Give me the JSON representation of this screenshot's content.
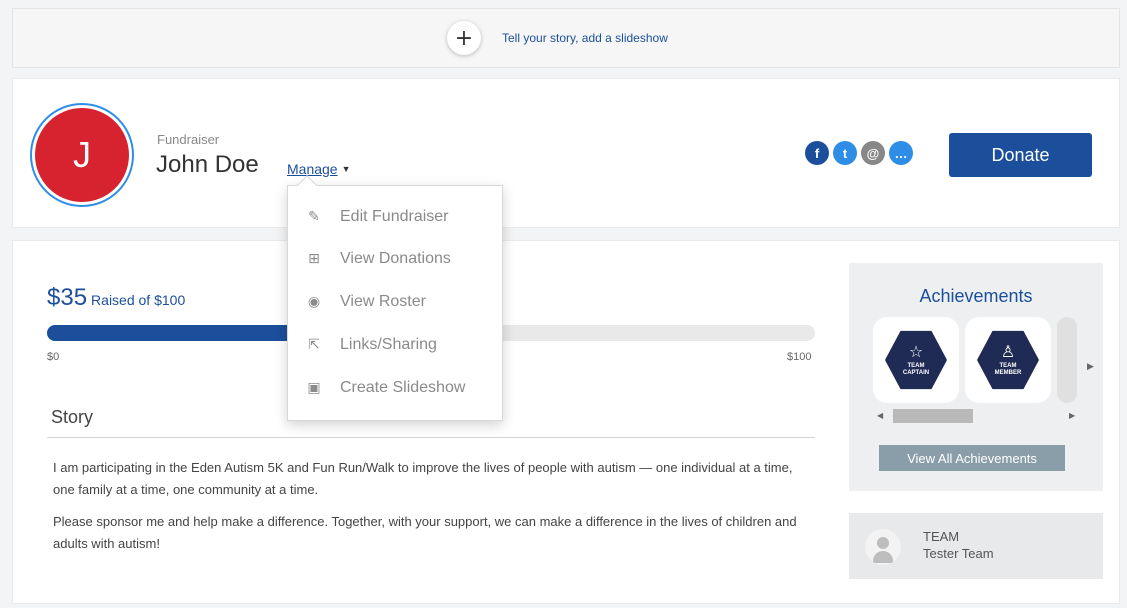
{
  "top_bar": {
    "add_icon": "+",
    "add_text": "Tell your story, add a slideshow"
  },
  "header": {
    "avatar_initial": "J",
    "role": "Fundraiser",
    "name": "John Doe",
    "manage_label": "Manage",
    "social": [
      {
        "icon": "facebook-icon",
        "glyph": "f",
        "color": "#1b4f9b"
      },
      {
        "icon": "twitter-icon",
        "glyph": "t",
        "color": "#2e8ee6"
      },
      {
        "icon": "email-icon",
        "glyph": "@",
        "color": "#888888"
      },
      {
        "icon": "chat-icon",
        "glyph": "…",
        "color": "#2e8ee6"
      }
    ],
    "donate_label": "Donate"
  },
  "manage_menu": {
    "items": [
      {
        "label": "Edit Fundraiser",
        "icon": "edit-icon",
        "glyph": "✎"
      },
      {
        "label": "View Donations",
        "icon": "gift-icon",
        "glyph": "⊞"
      },
      {
        "label": "View Roster",
        "icon": "eye-icon",
        "glyph": "◉"
      },
      {
        "label": "Links/Sharing",
        "icon": "share-icon",
        "glyph": "⇱"
      },
      {
        "label": "Create Slideshow",
        "icon": "image-icon",
        "glyph": "▣"
      }
    ]
  },
  "progress": {
    "amount": "$35",
    "raised_label": "Raised of $100",
    "min_label": "$0",
    "max_label": "$100",
    "fraction": 0.35
  },
  "story": {
    "title": "Story",
    "paragraphs": [
      "I am participating in the Eden Autism 5K and Fun Run/Walk to improve the lives of people with autism — one individual at a time, one family at a time, one community at a time.",
      "Please sponsor me and help make a difference. Together, with your support, we can make a difference in the lives of children and adults with autism!"
    ]
  },
  "achievements": {
    "title": "Achievements",
    "badges": [
      {
        "label_line1": "TEAM",
        "label_line2": "CAPTAIN",
        "glyph": "☆"
      },
      {
        "label_line1": "TEAM",
        "label_line2": "MEMBER",
        "glyph": "♙"
      }
    ],
    "view_all_label": "View All Achievements"
  },
  "team": {
    "label": "TEAM",
    "name": "Tester Team"
  },
  "colors": {
    "brand_blue": "#1b4f9b",
    "light_blue": "#2e8ee6",
    "avatar_red": "#d7232f"
  }
}
